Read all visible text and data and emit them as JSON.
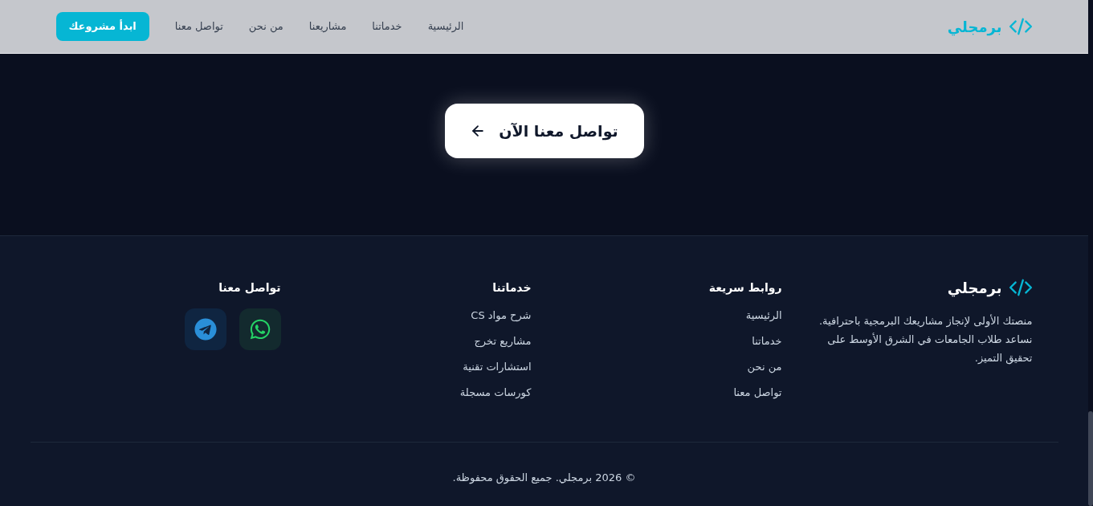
{
  "header": {
    "brand": "برمجلي",
    "nav": [
      {
        "label": "الرئيسية"
      },
      {
        "label": "خدماتنا"
      },
      {
        "label": "مشاريعنا"
      },
      {
        "label": "من نحن"
      },
      {
        "label": "تواصل معنا"
      }
    ],
    "cta": "ابدأ مشروعك"
  },
  "hero": {
    "button": "تواصل معنا الآن"
  },
  "footer": {
    "brand": "برمجلي",
    "about": "منصتك الأولى لإنجاز مشاريعك البرمجية باحترافية. نساعد طلاب الجامعات في الشرق الأوسط على تحقيق التميز.",
    "columns": [
      {
        "title": "روابط سريعة",
        "links": [
          "الرئيسية",
          "خدماتنا",
          "من نحن",
          "تواصل معنا"
        ]
      },
      {
        "title": "خدماتنا",
        "links": [
          "شرح مواد CS",
          "مشاريع تخرج",
          "استشارات تقنية",
          "كورسات مسجلة"
        ]
      }
    ],
    "contact": {
      "title": "تواصل معنا",
      "socials": [
        {
          "kind": "whatsapp"
        },
        {
          "kind": "telegram"
        }
      ]
    },
    "copyright": "© 2026 برمجلي. جميع الحقوق محفوظة."
  }
}
